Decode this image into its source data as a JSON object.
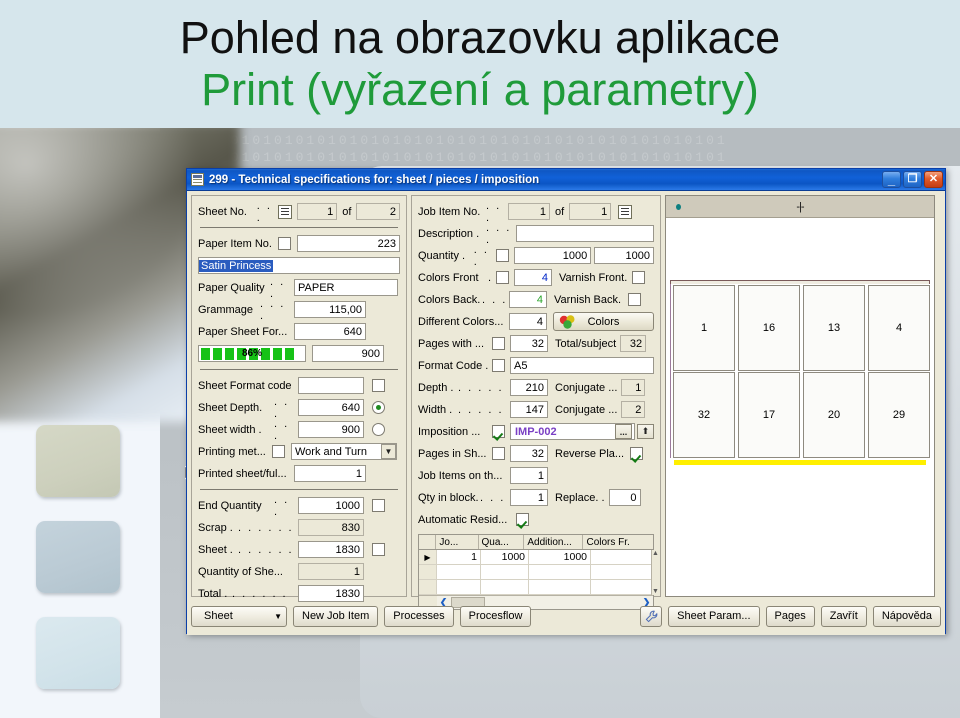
{
  "slide": {
    "title_line1": "Pohled na obrazovku aplikace",
    "title_line2": "Print (vyřazení a parametry)",
    "binary_pattern": "0101010101010101010101010101010101010101010101010101"
  },
  "dialog": {
    "title": "299 - Technical specifications for: sheet / pieces / imposition",
    "window_buttons": {
      "minimize": "_",
      "maximize": "❐",
      "close": "✕"
    }
  },
  "left_panel": {
    "sheet_no": {
      "label": "Sheet No.",
      "dots": ". . .",
      "icon": "list-icon",
      "value": "1",
      "of_label": "of",
      "total": "2"
    },
    "paper_item_no": {
      "label": "Paper Item No.",
      "checked": false,
      "value": "223"
    },
    "paper_name": {
      "value": "Satin Princess",
      "selected": true
    },
    "paper_quality": {
      "label": "Paper Quality",
      "dots": ". . .",
      "value": "PAPER"
    },
    "grammage": {
      "label": "Grammage",
      "dots": ". . . .",
      "value": "115,00"
    },
    "paper_sheet_format": {
      "label": "Paper Sheet For...",
      "value": "640"
    },
    "progress": {
      "percent": "86%",
      "value": "900"
    },
    "sheet_format_code": {
      "label": "Sheet Format code",
      "value": "",
      "checked": false
    },
    "sheet_depth": {
      "label": "Sheet Depth.",
      "dots": ". . .",
      "value": "640",
      "radio": true
    },
    "sheet_width": {
      "label": "Sheet width .",
      "dots": ". . .",
      "value": "900",
      "radio": false
    },
    "printing_method": {
      "label": "Printing met...",
      "checked": false,
      "value": "Work and Turn"
    },
    "printed_sheet_full": {
      "label": "Printed sheet/ful...",
      "value": "1"
    },
    "end_quantity": {
      "label": "End Quantity",
      "dots": ". . .",
      "value": "1000",
      "checked": false
    },
    "scrap": {
      "label": "Scrap .",
      "dots": ". . . . . .",
      "value": "830"
    },
    "sheet": {
      "label": "Sheet .",
      "dots": ". . . . . .",
      "value": "1830",
      "checked": false
    },
    "quantity_of_sheets": {
      "label": "Quantity of She...",
      "value": "1"
    },
    "total": {
      "label": "Total .",
      "dots": ". . . . . .",
      "value": "1830"
    }
  },
  "middle_panel": {
    "job_item_no": {
      "label": "Job Item No.",
      "dots": ". . .",
      "value": "1",
      "of_label": "of",
      "total": "1",
      "icon": "list-icon"
    },
    "description": {
      "label": "Description .",
      "dots": ". . . .",
      "value": ""
    },
    "quantity": {
      "label": "Quantity .",
      "dots": ". . .",
      "checked": false,
      "value1": "1000",
      "value2": "1000"
    },
    "colors_front": {
      "label": "Colors Front",
      "dots": " .",
      "checked": false,
      "value": "4"
    },
    "varnish_front": {
      "label": "Varnish Front",
      "dots": " .",
      "checked": false
    },
    "colors_back": {
      "label": "Colors Back.",
      "dots": ". . .",
      "value": "4"
    },
    "varnish_back": {
      "label": "Varnish Back",
      "dots": " .",
      "checked": false
    },
    "different_colors": {
      "label": "Different Colors...",
      "value": "4"
    },
    "colors_button": {
      "label": "Colors",
      "icon": "balloons-icon"
    },
    "pages_with": {
      "label": "Pages with ...",
      "checked": false,
      "value": "32"
    },
    "total_subject": {
      "label": "Total/subject",
      "value": "32"
    },
    "format_code": {
      "label": "Format Code .",
      "checked": false,
      "value": "A5"
    },
    "depth": {
      "label": "Depth .",
      "dots": ". . . . .",
      "value": "210"
    },
    "conjugate1": {
      "label": "Conjugate ...",
      "value": "1"
    },
    "width": {
      "label": "Width .",
      "dots": ". . . . .",
      "value": "147"
    },
    "conjugate2": {
      "label": "Conjugate ...",
      "value": "2"
    },
    "imposition": {
      "label": "Imposition ...",
      "checked": true,
      "value": "IMP-002",
      "browse_label": "...",
      "up_label": "⬆"
    },
    "pages_in_sheet": {
      "label": "Pages in Sh...",
      "checked": false,
      "value": "32"
    },
    "reverse_plate": {
      "label": "Reverse Pla...",
      "checked": true
    },
    "job_items_on_sheet": {
      "label": "Job Items on th...",
      "value": "1"
    },
    "qty_in_block": {
      "label": "Qty in block.",
      "dots": ". . .",
      "value": "1"
    },
    "replace": {
      "label": "Replace. .",
      "value": "0"
    },
    "automatic_residue": {
      "label": "Automatic Resid...",
      "checked": true
    },
    "grid": {
      "columns": [
        "Jo...",
        "Qua...",
        "Addition...",
        "Colors Fr."
      ],
      "rows": [
        {
          "marker": "▶",
          "cells": [
            "1",
            "1000",
            "1000",
            ""
          ]
        },
        {
          "marker": "",
          "cells": [
            "",
            "",
            "",
            ""
          ]
        },
        {
          "marker": "",
          "cells": [
            "",
            "",
            "",
            ""
          ]
        }
      ],
      "scroll_up": "▲",
      "scroll_down": "▼",
      "scroll_left": "❮",
      "scroll_right": "❯"
    }
  },
  "preview": {
    "register_mark": "-|-",
    "pages_row1": [
      "1",
      "16",
      "13",
      "4"
    ],
    "pages_row2": [
      "32",
      "17",
      "20",
      "29"
    ],
    "colors": {
      "yellow_bar": "#ffef00",
      "dot": "#0d7f80"
    }
  },
  "buttons": {
    "sheet": "Sheet",
    "sheet_arrow": "▼",
    "new_job_item": "New Job Item",
    "processes": "Processes",
    "procesflow": "Procesflow",
    "wrench_icon": "wrench-icon",
    "sheet_param": "Sheet Param...",
    "pages": "Pages",
    "close": "Zavřít",
    "help": "Nápověda"
  }
}
